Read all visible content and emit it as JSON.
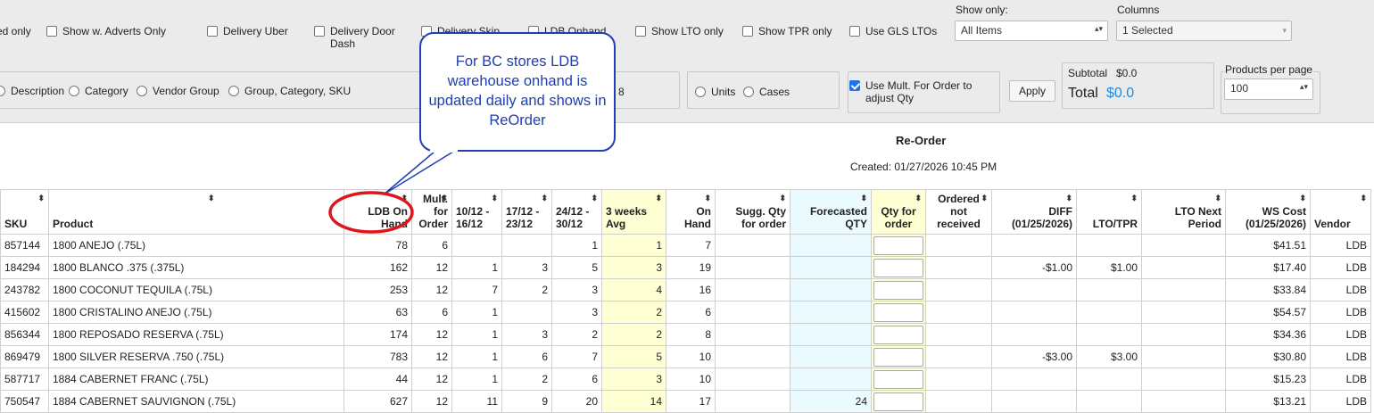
{
  "filters": {
    "checkboxes_row1": [
      {
        "label": "ed only"
      },
      {
        "label": "Show w. Adverts Only"
      },
      {
        "label": "Delivery Uber"
      },
      {
        "label": "Delivery Door Dash"
      },
      {
        "label": "Delivery Skip"
      },
      {
        "label": "LDB Onhand"
      },
      {
        "label": "Show LTO only"
      },
      {
        "label": "Show TPR only"
      },
      {
        "label": "Use GLS LTOs"
      }
    ],
    "show_only": {
      "label": "Show only:",
      "value": "All Items"
    },
    "columns": {
      "label": "Columns",
      "value": "1 Selected"
    },
    "group_by": [
      "Description",
      "Category",
      "Vendor Group",
      "Group, Category, SKU"
    ],
    "partial_value": "8",
    "units_cases": [
      "Units",
      "Cases"
    ],
    "use_mult": {
      "label": "Use Mult. For Order to adjust Qty",
      "checked": true
    },
    "apply_label": "Apply",
    "subtotal": {
      "label": "Subtotal",
      "value": "$0.0"
    },
    "total": {
      "label": "Total",
      "value": "$0.0"
    },
    "per_page": {
      "label": "Products per page",
      "value": "100"
    }
  },
  "report": {
    "title": "Re-Order",
    "created": "Created: 01/27/2026 10:45 PM"
  },
  "callout": {
    "text": "For BC stores LDB warehouse onhand is updated daily and shows in ReOrder"
  },
  "table": {
    "headers": [
      "SKU",
      "Product",
      "LDB On Hand",
      "Mult. for Order",
      "10/12 - 16/12",
      "17/12 - 23/12",
      "24/12 - 30/12",
      "3 weeks Avg",
      "On Hand",
      "Sugg. Qty for order",
      "Forecasted QTY",
      "Qty for order",
      "Ordered not received",
      "DIFF (01/25/2026)",
      "LTO/TPR",
      "LTO Next Period",
      "WS Cost (01/25/2026)",
      "Vendor"
    ],
    "rows": [
      [
        "857144",
        "1800 ANEJO (.75L)",
        "78",
        "6",
        "",
        "",
        "1",
        "1",
        "7",
        "",
        "",
        "",
        "",
        "",
        "",
        "",
        "$41.51",
        "LDB"
      ],
      [
        "184294",
        "1800 BLANCO .375 (.375L)",
        "162",
        "12",
        "1",
        "3",
        "5",
        "3",
        "19",
        "",
        "",
        "",
        "",
        "-$1.00",
        "$1.00",
        "",
        "$17.40",
        "LDB"
      ],
      [
        "243782",
        "1800 COCONUT TEQUILA (.75L)",
        "253",
        "12",
        "7",
        "2",
        "3",
        "4",
        "16",
        "",
        "",
        "",
        "",
        "",
        "",
        "",
        "$33.84",
        "LDB"
      ],
      [
        "415602",
        "1800 CRISTALINO ANEJO (.75L)",
        "63",
        "6",
        "1",
        "",
        "3",
        "2",
        "6",
        "",
        "",
        "",
        "",
        "",
        "",
        "",
        "$54.57",
        "LDB"
      ],
      [
        "856344",
        "1800 REPOSADO RESERVA (.75L)",
        "174",
        "12",
        "1",
        "3",
        "2",
        "2",
        "8",
        "",
        "",
        "",
        "",
        "",
        "",
        "",
        "$34.36",
        "LDB"
      ],
      [
        "869479",
        "1800 SILVER RESERVA .750 (.75L)",
        "783",
        "12",
        "1",
        "6",
        "7",
        "5",
        "10",
        "",
        "",
        "",
        "",
        "-$3.00",
        "$3.00",
        "",
        "$30.80",
        "LDB"
      ],
      [
        "587717",
        "1884 CABERNET FRANC (.75L)",
        "44",
        "12",
        "1",
        "2",
        "6",
        "3",
        "10",
        "",
        "",
        "",
        "",
        "",
        "",
        "",
        "$15.23",
        "LDB"
      ],
      [
        "750547",
        "1884 CABERNET SAUVIGNON (.75L)",
        "627",
        "12",
        "11",
        "9",
        "20",
        "14",
        "17",
        "",
        "24",
        "",
        "",
        "",
        "",
        "",
        "$13.21",
        "LDB"
      ]
    ]
  },
  "colors": {
    "highlight_yellow": "#ffffd4",
    "highlight_cyan": "#eafaff",
    "callout_blue": "#1f3fb0",
    "circle_red": "#e0151b"
  }
}
